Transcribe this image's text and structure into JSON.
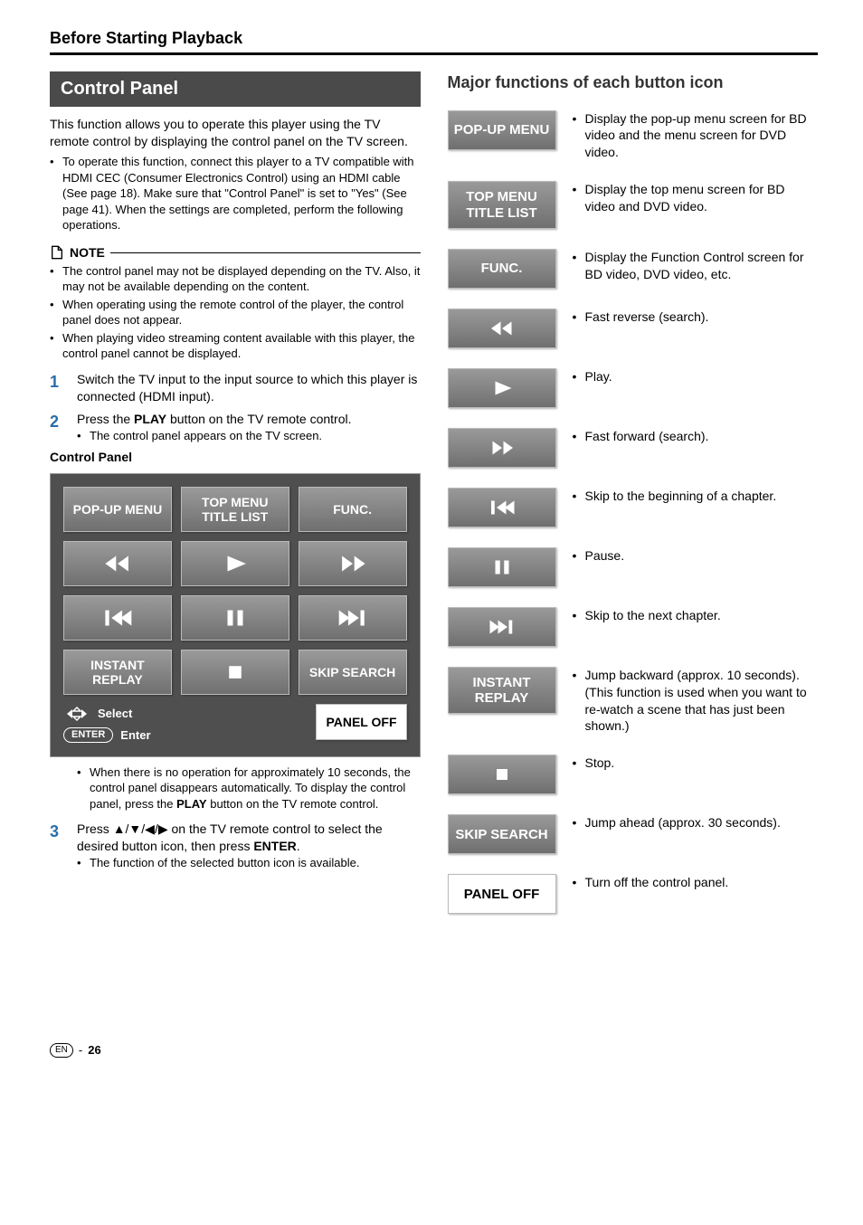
{
  "header": {
    "title": "Before Starting Playback"
  },
  "left": {
    "sectionTitle": "Control Panel",
    "intro": "This function allows you to operate this player using the TV remote control by displaying the control panel on the TV screen.",
    "introBullet": "To operate this function, connect this player to a TV compatible with HDMI CEC (Consumer Electronics Control) using an HDMI cable (See page 18). Make sure that \"Control Panel\" is set to \"Yes\" (See page 41). When the settings are completed, perform the following operations.",
    "noteLabel": "NOTE",
    "notes": [
      "The control panel may not be displayed depending on the TV. Also, it may not be available depending on the content.",
      "When operating using the remote control of the player, the control panel does not appear.",
      "When playing video streaming content available with this player, the control panel cannot be displayed."
    ],
    "step1": {
      "num": "1",
      "text": "Switch the TV input to the input source to which this player is connected (HDMI input)."
    },
    "step2": {
      "num": "2",
      "prefix": "Press the ",
      "bold": "PLAY",
      "suffix": " button on the TV remote control.",
      "sub": "The control panel appears on the TV screen."
    },
    "controlPanelLabel": "Control Panel",
    "panel": {
      "b1": "POP-UP MENU",
      "b2": "TOP MENU TITLE LIST",
      "b3": "FUNC.",
      "b10": "INSTANT REPLAY",
      "b12": "SKIP SEARCH",
      "panelOff": "PANEL OFF",
      "selectLabel": "Select",
      "enterPill": "ENTER",
      "enterLabel": "Enter"
    },
    "afterPanelNote": {
      "prefix": "When there is no operation for approximately 10 seconds, the control panel disappears automatically. To display the control panel, press the ",
      "bold": "PLAY",
      "suffix": " button on the TV remote control."
    },
    "step3": {
      "num": "3",
      "prefix": "Press ",
      "arrows": "▲/▼/◀/▶",
      "mid": " on the TV remote control to select the desired button icon, then press ",
      "bold": "ENTER",
      "suffix": ".",
      "sub": "The function of the selected button icon is available."
    }
  },
  "right": {
    "title": "Major functions of each button icon",
    "rows": [
      {
        "type": "text",
        "label": "POP-UP MENU",
        "desc": "Display the pop-up menu screen for BD video and the menu screen for DVD video."
      },
      {
        "type": "text",
        "label": "TOP MENU TITLE LIST",
        "desc": "Display the top menu screen for BD video and DVD video."
      },
      {
        "type": "text",
        "label": "FUNC.",
        "desc": "Display the Function Control screen for BD video, DVD video, etc."
      },
      {
        "type": "icon",
        "icon": "rew",
        "desc": "Fast reverse (search)."
      },
      {
        "type": "icon",
        "icon": "play",
        "desc": "Play."
      },
      {
        "type": "icon",
        "icon": "ffwd",
        "desc": "Fast forward (search)."
      },
      {
        "type": "icon",
        "icon": "prev",
        "desc": "Skip to the beginning of a chapter."
      },
      {
        "type": "icon",
        "icon": "pause",
        "desc": "Pause."
      },
      {
        "type": "icon",
        "icon": "next",
        "desc": "Skip to the next chapter."
      },
      {
        "type": "text",
        "label": "INSTANT REPLAY",
        "desc": "Jump backward (approx. 10 seconds). (This function is used when you want to re-watch a scene that has just been shown.)"
      },
      {
        "type": "icon",
        "icon": "stop",
        "desc": "Stop."
      },
      {
        "type": "text",
        "label": "SKIP SEARCH",
        "desc": "Jump ahead (approx. 30 seconds)."
      },
      {
        "type": "text-white",
        "label": "PANEL OFF",
        "desc": "Turn off the control panel."
      }
    ]
  },
  "footer": {
    "lang": "EN",
    "dash": "-",
    "page": "26"
  }
}
